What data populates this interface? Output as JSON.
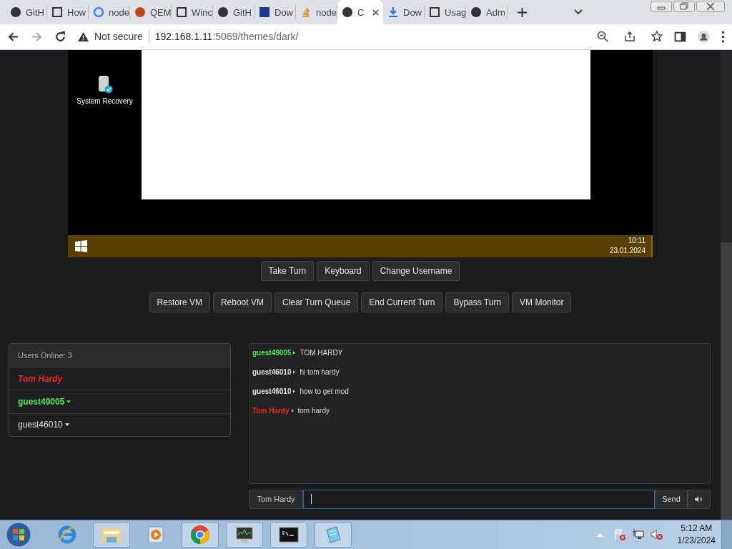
{
  "browser": {
    "tabs": [
      {
        "title": "GitH",
        "selected": false
      },
      {
        "title": "How",
        "selected": false
      },
      {
        "title": "node",
        "selected": false
      },
      {
        "title": "QEM",
        "selected": false
      },
      {
        "title": "Winc",
        "selected": false
      },
      {
        "title": "GitH",
        "selected": false
      },
      {
        "title": "Dow",
        "selected": false
      },
      {
        "title": "node",
        "selected": false
      },
      {
        "title": "C",
        "selected": true
      },
      {
        "title": "Dow",
        "selected": false
      },
      {
        "title": "Usag",
        "selected": false
      },
      {
        "title": "Adm",
        "selected": false
      }
    ],
    "security": "Not secure",
    "url_host": "192.168.1.11",
    "url_rest": ":5069/themes/dark/"
  },
  "vm": {
    "desktop_icon": "System Recovery",
    "clock_time": "10:11",
    "clock_date": "23.01.2024"
  },
  "controls": [
    "Take Turn",
    "Keyboard",
    "Change Username"
  ],
  "admin_controls": [
    "Restore VM",
    "Reboot VM",
    "Clear Turn Queue",
    "End Current Turn",
    "Bypass Turn",
    "VM Monitor"
  ],
  "users": {
    "header": "Users Online: 3",
    "list": [
      {
        "name": "Tom Hardy",
        "kind": "self",
        "color": "#e8282b"
      },
      {
        "name": "guest49005",
        "kind": "highlighted",
        "color": "#53e85a"
      },
      {
        "name": "guest46010",
        "kind": "plain",
        "color": "#e0e0e0"
      }
    ]
  },
  "chat": {
    "messages": [
      {
        "user": "guest49005",
        "color": "#53e85a",
        "text": "TOM HARDY"
      },
      {
        "user": "guest46010",
        "color": "#e0e0e0",
        "text": "hi tom hardy"
      },
      {
        "user": "guest46010",
        "color": "#e0e0e0",
        "text": "how to get mod"
      },
      {
        "user": "Tom Hardy",
        "color": "#e8282b",
        "text": "tom hardy"
      }
    ],
    "username": "Tom Hardy",
    "send": "Send"
  },
  "taskbar": {
    "time": "5:12 AM",
    "date": "1/23/2024"
  }
}
